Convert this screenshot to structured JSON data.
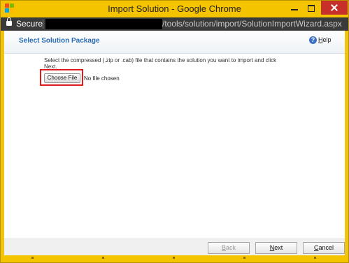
{
  "window": {
    "title": "Import Solution - Google Chrome",
    "colors": {
      "title_bar": "#f5c400",
      "address_bar": "#3a3a3a",
      "close_button": "#c7302a"
    }
  },
  "address_bar": {
    "secure_label": "Secure",
    "url_visible": "/tools/solution/import/SolutionImportWizard.aspx"
  },
  "page": {
    "heading": "Select Solution Package",
    "help_label_first": "H",
    "help_label_rest": "elp",
    "instructions": "Select the compressed (.zip or .cab) file that contains the solution you want to import and click Next.",
    "choose_file_label": "Choose File",
    "no_file_text": "No file chosen",
    "accent_color": "#2a6bb2",
    "highlight_color": "#e0191e"
  },
  "footer": {
    "back_first": "B",
    "back_rest": "ack",
    "next_first": "N",
    "next_rest": "ext",
    "cancel_first": "C",
    "cancel_rest": "ancel",
    "back_enabled": false
  }
}
